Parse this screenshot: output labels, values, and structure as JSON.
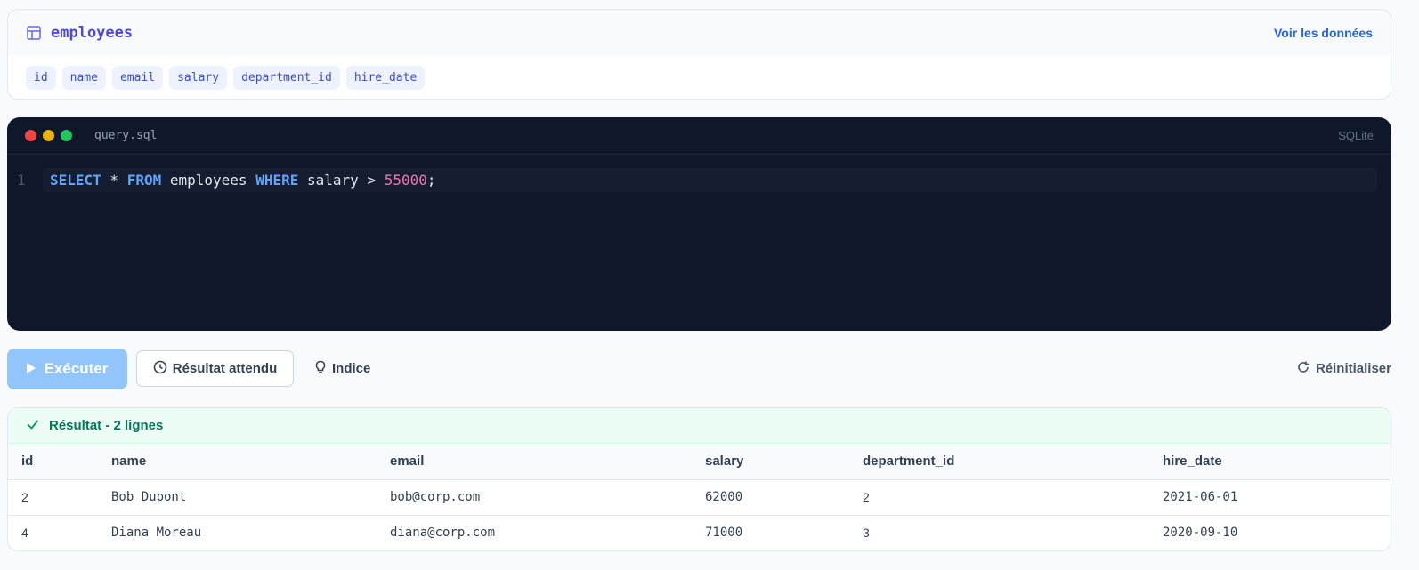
{
  "schema": {
    "table_name": "employees",
    "view_data_label": "Voir les données",
    "columns": [
      "id",
      "name",
      "email",
      "salary",
      "department_id",
      "hire_date"
    ]
  },
  "editor": {
    "filename": "query.sql",
    "language": "SQLite",
    "line_number": "1",
    "query": {
      "select": "SELECT",
      "star": " * ",
      "from": "FROM",
      "table": " employees ",
      "where": "WHERE",
      "condition": " salary > ",
      "value": "55000",
      "end": ";"
    },
    "dot_colors": [
      "#ef4444",
      "#eab308",
      "#22c55e"
    ]
  },
  "toolbar": {
    "run_label": "Exécuter",
    "expected_label": "Résultat attendu",
    "hint_label": "Indice",
    "reset_label": "Réinitialiser"
  },
  "result": {
    "status": "Résultat - 2 lignes",
    "headers": [
      "id",
      "name",
      "email",
      "salary",
      "department_id",
      "hire_date"
    ],
    "rows": [
      [
        "2",
        "Bob Dupont",
        "bob@corp.com",
        "62000",
        "2",
        "2021-06-01"
      ],
      [
        "4",
        "Diana Moreau",
        "diana@corp.com",
        "71000",
        "3",
        "2020-09-10"
      ]
    ]
  }
}
